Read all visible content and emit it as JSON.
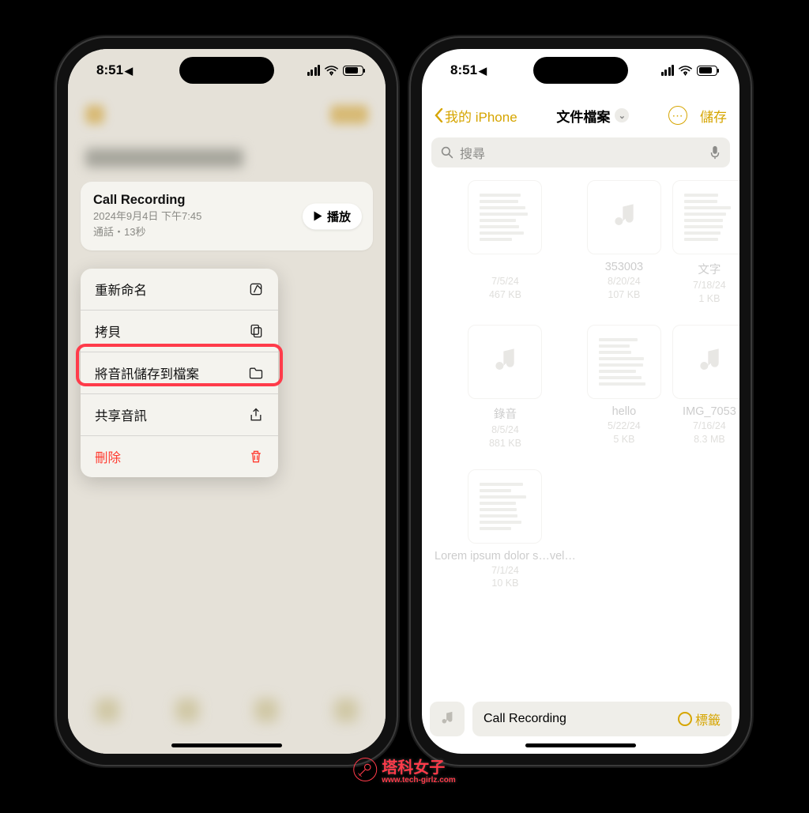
{
  "status": {
    "time": "8:51",
    "loc_arrow": "↗"
  },
  "left": {
    "card": {
      "title": "Call Recording",
      "datetime": "2024年9月4日 下午7:45",
      "meta": "通話・13秒",
      "play": "播放"
    },
    "menu": {
      "rename": "重新命名",
      "copy": "拷貝",
      "save_audio": "將音訊儲存到檔案",
      "share_audio": "共享音訊",
      "delete": "刪除"
    }
  },
  "right": {
    "back": "我的 iPhone",
    "folder": "文件檔案",
    "save": "儲存",
    "search_placeholder": "搜尋",
    "files": [
      {
        "name": "",
        "date": "7/5/24",
        "size": "467 KB",
        "kind": "doc"
      },
      {
        "name": "353003",
        "date": "8/20/24",
        "size": "107 KB",
        "kind": "audio"
      },
      {
        "name": "文字",
        "date": "7/18/24",
        "size": "1 KB",
        "kind": "doc"
      },
      {
        "name": "錄音",
        "date": "8/5/24",
        "size": "881 KB",
        "kind": "audio"
      },
      {
        "name": "hello",
        "date": "5/22/24",
        "size": "5 KB",
        "kind": "doc"
      },
      {
        "name": "IMG_7053",
        "date": "7/16/24",
        "size": "8.3 MB",
        "kind": "audio"
      },
      {
        "name": "Lorem ipsum dolor s…vel…",
        "date": "7/1/24",
        "size": "10 KB",
        "kind": "doc"
      }
    ],
    "save_name": "Call Recording",
    "tag_label": "標籤"
  },
  "watermark": {
    "big": "塔科女子",
    "small": "www.tech-girlz.com"
  }
}
